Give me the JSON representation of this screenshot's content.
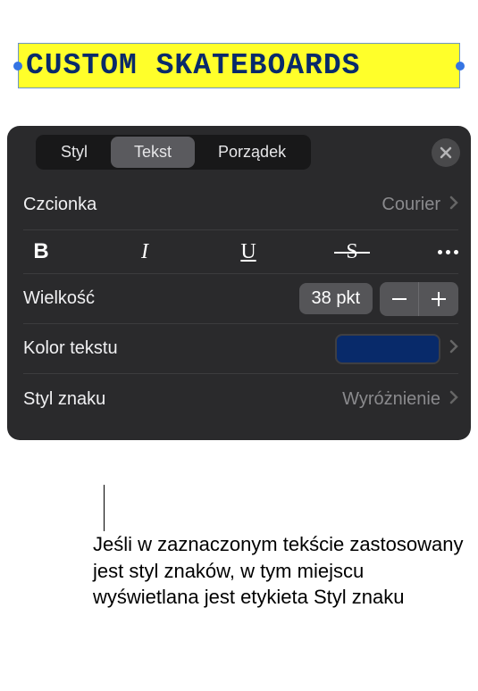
{
  "canvas": {
    "selected_text": "CUSTOM SKATEBOARDS"
  },
  "panel": {
    "tabs": {
      "style": "Styl",
      "text": "Tekst",
      "arrange": "Porządek"
    },
    "font": {
      "label": "Czcionka",
      "value": "Courier"
    },
    "style_buttons": {
      "bold": "B",
      "italic": "I",
      "underline": "U",
      "strike": "S"
    },
    "size": {
      "label": "Wielkość",
      "value": "38 pkt"
    },
    "text_color": {
      "label": "Kolor tekstu",
      "hex": "#082a6a"
    },
    "char_style": {
      "label": "Styl znaku",
      "value": "Wyróżnienie"
    }
  },
  "callout": {
    "text": "Jeśli w zaznaczonym tekście zastosowany jest styl znaków, w tym miejscu wyświetlana jest etykieta Styl znaku"
  }
}
